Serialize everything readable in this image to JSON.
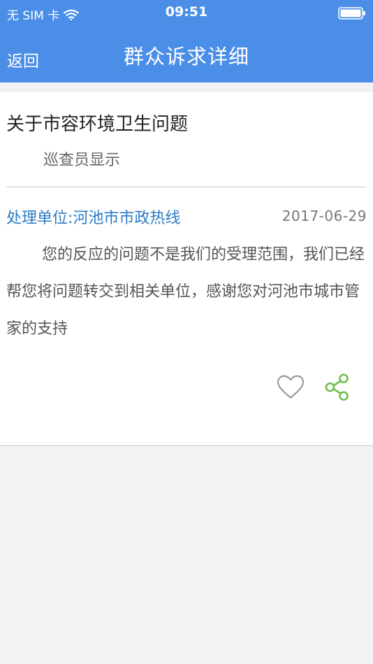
{
  "status_bar": {
    "carrier": "无 SIM 卡",
    "time": "09:51",
    "wifi_icon": "wifi-icon",
    "battery_icon": "battery-icon"
  },
  "nav": {
    "back_label": "返回",
    "title": "群众诉求详细"
  },
  "topic": {
    "title": "关于市容环境卫生问题",
    "subtitle": "巡查员显示"
  },
  "reply": {
    "unit": "处理单位:河池市市政热线",
    "date": "2017-06-29",
    "body": "您的反应的问题不是我们的受理范围，我们已经帮您将问题转交到相关单位，感谢您对河池市城市管家的支持"
  },
  "actions": {
    "like_icon": "heart-outline-icon",
    "share_icon": "share-icon"
  },
  "colors": {
    "header": "#4a8ee8",
    "unit_text": "#2b7bc8",
    "share_icon": "#6cbf4a"
  }
}
